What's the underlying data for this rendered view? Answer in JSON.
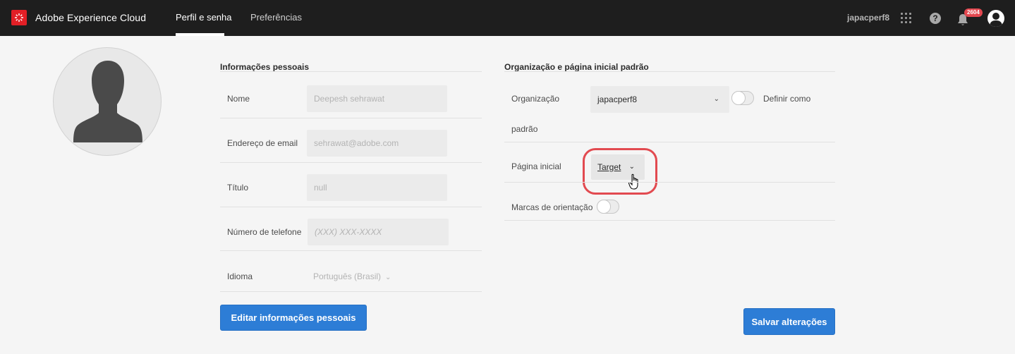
{
  "topbar": {
    "brand": "Adobe Experience Cloud",
    "tabs": [
      {
        "label": "Perfil e senha",
        "active": true
      },
      {
        "label": "Preferências",
        "active": false
      }
    ],
    "username": "japacperf8",
    "notifications_count": "2604",
    "icons": [
      "adobe-logo-icon",
      "apps-grid-icon",
      "help-icon",
      "bell-icon",
      "user-profile-icon"
    ],
    "accent_color": "#e21f26"
  },
  "personal": {
    "section_title": "Informações pessoais",
    "fields": [
      {
        "label": "Nome",
        "value": "Deepesh sehrawat"
      },
      {
        "label": "Endereço de email",
        "value": "sehrawat@adobe.com"
      },
      {
        "label": "Título",
        "value": "null"
      },
      {
        "label": "Número de telefone",
        "placeholder": "(XXX) XXX-XXXX"
      }
    ],
    "language_label": "Idioma",
    "language_value": "Português (Brasil)",
    "edit_button": "Editar informações pessoais"
  },
  "org": {
    "section_title": "Organização e página inicial padrão",
    "org_label": "Organização",
    "org_value": "japacperf8",
    "set_default_label": "Definir como",
    "set_default_label_cont": "padrão",
    "home_label": "Página inicial",
    "home_value": "Target",
    "guides_label": "Marcas de orientação",
    "save_button": "Salvar alterações"
  }
}
